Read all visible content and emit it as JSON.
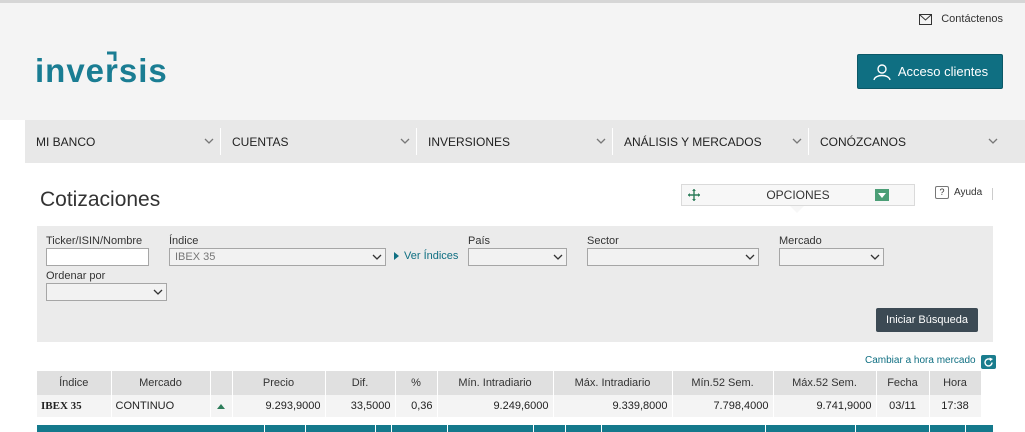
{
  "header": {
    "contact_label": "Contáctenos",
    "logo_text": "inversis",
    "access_button_label": "Acceso clientes"
  },
  "nav": {
    "items": [
      {
        "label": "MI BANCO"
      },
      {
        "label": "CUENTAS"
      },
      {
        "label": "INVERSIONES"
      },
      {
        "label": "ANÁLISIS Y MERCADOS"
      },
      {
        "label": "CONÓZCANOS"
      }
    ]
  },
  "page": {
    "title": "Cotizaciones",
    "options_label": "OPCIONES",
    "help_label": "Ayuda"
  },
  "search": {
    "ticker_label": "Ticker/ISIN/Nombre",
    "ticker_value": "",
    "index_label": "Índice",
    "index_value": "IBEX 35",
    "ver_indices_label": "Ver Índices",
    "country_label": "País",
    "country_value": "",
    "sector_label": "Sector",
    "sector_value": "",
    "market_label": "Mercado",
    "market_value": "",
    "sort_label": "Ordenar por",
    "sort_value": "",
    "search_button_label": "Iniciar Búsqueda"
  },
  "table": {
    "change_hour_label": "Cambiar a hora mercado",
    "headers": [
      "Índice",
      "Mercado",
      "",
      "Precio",
      "Dif.",
      "%",
      "Mín. Intradiario",
      "Máx. Intradiario",
      "Mín.52 Sem.",
      "Máx.52 Sem.",
      "Fecha",
      "Hora"
    ],
    "rows": [
      {
        "index": "IBEX 35",
        "market": "CONTINUO",
        "trend": "up",
        "price": "9.293,9000",
        "diff": "33,5000",
        "pct": "0,36",
        "min_intraday": "9.249,6000",
        "max_intraday": "9.339,8000",
        "min_52w": "7.798,4000",
        "max_52w": "9.741,9000",
        "date": "03/11",
        "time": "17:38"
      }
    ]
  },
  "colors": {
    "brand_teal": "#0f6f82",
    "nav_background": "#e8e8e8",
    "trend_up": "#2d7d5a"
  }
}
